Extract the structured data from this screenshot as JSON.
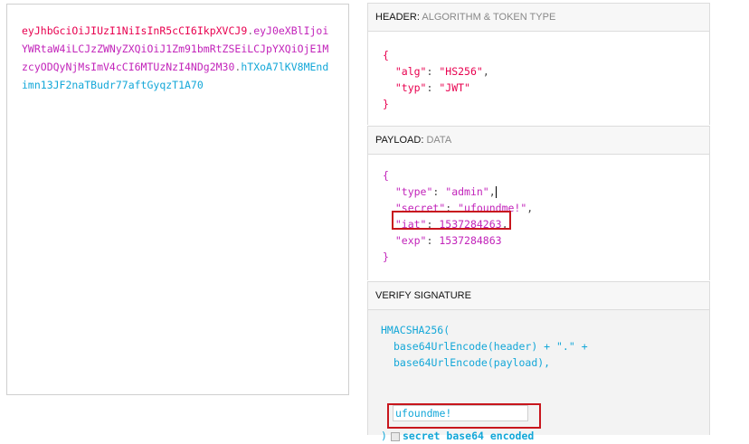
{
  "encoded": {
    "header": "eyJhbGciOiJIUzI1NiIsInR5cCI6IkpXVCJ9",
    "payload": "eyJ0eXBlIjoiYWRtaW4iLCJzZWNyZXQiOiJ1Zm91bmRtZSEiLCJpYXQiOjE1MzcyODQyNjMsImV4cCI6MTUzNzI4NDg2M30",
    "signature": "hTXoA7lKV8MEndimn13JF2naTBudr77aftGyqzT1A70",
    "dot": "."
  },
  "header_section": {
    "title": "HEADER:",
    "subtitle": "ALGORITHM & TOKEN TYPE",
    "open": "{",
    "close": "}",
    "fields": [
      {
        "key": "\"alg\"",
        "value": "\"HS256\"",
        "sep": ","
      },
      {
        "key": "\"typ\"",
        "value": "\"JWT\"",
        "sep": ""
      }
    ]
  },
  "payload_section": {
    "title": "PAYLOAD:",
    "subtitle": "DATA",
    "open": "{",
    "close": "}",
    "fields": [
      {
        "key": "\"type\"",
        "value": "\"admin\"",
        "sep": ","
      },
      {
        "key": "\"secret\"",
        "value": "\"ufoundme!\"",
        "sep": ","
      },
      {
        "key": "\"iat\"",
        "value": "1537284263",
        "sep": ","
      },
      {
        "key": "\"exp\"",
        "value": "1537284863",
        "sep": ""
      }
    ]
  },
  "verify_section": {
    "title": "VERIFY SIGNATURE",
    "line1": "HMACSHA256(",
    "line2": "base64UrlEncode(header) + \".\" +",
    "line3": "base64UrlEncode(payload),",
    "secret_value": "ufoundme!",
    "close": ")",
    "b64_label": "secret base64 encoded"
  },
  "colors": {
    "header": "#e8004f",
    "payload": "#c224ba",
    "signature": "#13a7d8",
    "highlight": "#c8161d"
  }
}
